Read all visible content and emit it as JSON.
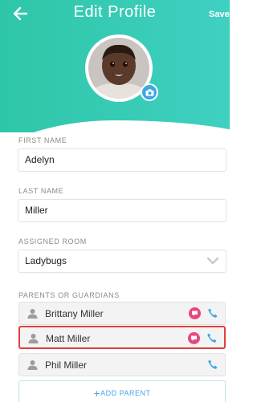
{
  "header": {
    "title": "Edit Profile",
    "save_label": "Save"
  },
  "fields": {
    "first_name": {
      "label": "FIRST NAME",
      "value": "Adelyn"
    },
    "last_name": {
      "label": "LAST NAME",
      "value": "Miller"
    },
    "assigned_room": {
      "label": "ASSIGNED ROOM",
      "value": "Ladybugs"
    }
  },
  "parents": {
    "label": "PARENTS OR GUARDIANS",
    "items": [
      {
        "name": "Brittany Miller",
        "has_chat": true
      },
      {
        "name": "Matt Miller",
        "has_chat": true,
        "highlighted": true
      },
      {
        "name": "Phil Miller",
        "has_chat": false
      }
    ],
    "add_label": "ADD PARENT"
  },
  "colors": {
    "accent": "#2ec6a8",
    "blue": "#3ca6e6",
    "chat": "#e8477f",
    "highlight": "#e0403a"
  }
}
